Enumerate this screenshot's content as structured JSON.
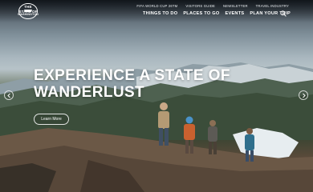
{
  "brand": {
    "logo_line1": "THE STATE OF",
    "logo_line2": "WASHINGTON"
  },
  "utility_nav": [
    {
      "label": "FIFA WORLD CUP 26TM"
    },
    {
      "label": "VISITORS GUIDE"
    },
    {
      "label": "NEWSLETTER"
    },
    {
      "label": "TRAVEL INDUSTRY"
    }
  ],
  "main_nav": [
    {
      "label": "THINGS TO DO"
    },
    {
      "label": "PLACES TO GO"
    },
    {
      "label": "EVENTS"
    },
    {
      "label": "PLAN YOUR TRIP"
    }
  ],
  "hero": {
    "headline_line1": "EXPERIENCE A STATE OF",
    "headline_line2": "WANDERLUST",
    "cta_label": "Learn More"
  },
  "icons": {
    "search": "search-icon",
    "prev": "chevron-left-icon",
    "next": "chevron-right-icon"
  }
}
